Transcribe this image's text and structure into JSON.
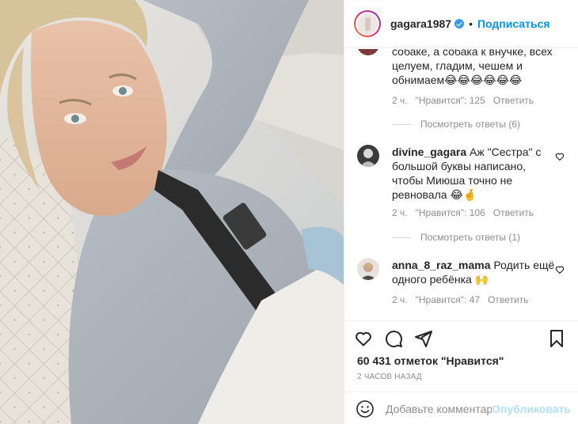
{
  "post": {
    "username": "gagara1987",
    "separator": "•",
    "follow_label": "Подписаться"
  },
  "comments": [
    {
      "text_lines": [
        "собаке, а собака к внучке, всех",
        "целуем, гладим, чешем и",
        "обнимаем😂😂😂😂😂😂"
      ],
      "time": "2 ч.",
      "likes": "\"Нравится\": 125",
      "reply_label": "Ответить",
      "view_replies": "Посмотреть ответы (6)"
    },
    {
      "username": "divine_gagara",
      "first_line": "Аж \"Сестра\" с",
      "text_lines": [
        "большой буквы написано,",
        "чтобы Миюша точно не",
        "ревновала 😂🤞"
      ],
      "time": "2 ч.",
      "likes": "\"Нравится\": 106",
      "reply_label": "Ответить",
      "view_replies": "Посмотреть ответы (1)"
    },
    {
      "username": "anna_8_raz_mama",
      "first_line": "Родить ещё",
      "text_lines": [
        "одного ребёнка 🙌"
      ],
      "time": "2 ч.",
      "likes": "\"Нравится\": 47",
      "reply_label": "Ответить"
    }
  ],
  "actions": {
    "like_count": "60 431 отметок \"Нравится\"",
    "time_ago": "2 часов назад",
    "comment_placeholder": "Добавьте комментарий...",
    "publish_label": "Опубликовать"
  },
  "colors": {
    "accent": "#0095f6",
    "publish_disabled": "#b2dffc",
    "muted_text": "#8e8e8e",
    "border": "#efefef"
  },
  "icons": [
    "verified-badge-icon",
    "heart-icon",
    "comment-icon",
    "share-icon",
    "bookmark-icon",
    "emoji-icon"
  ]
}
